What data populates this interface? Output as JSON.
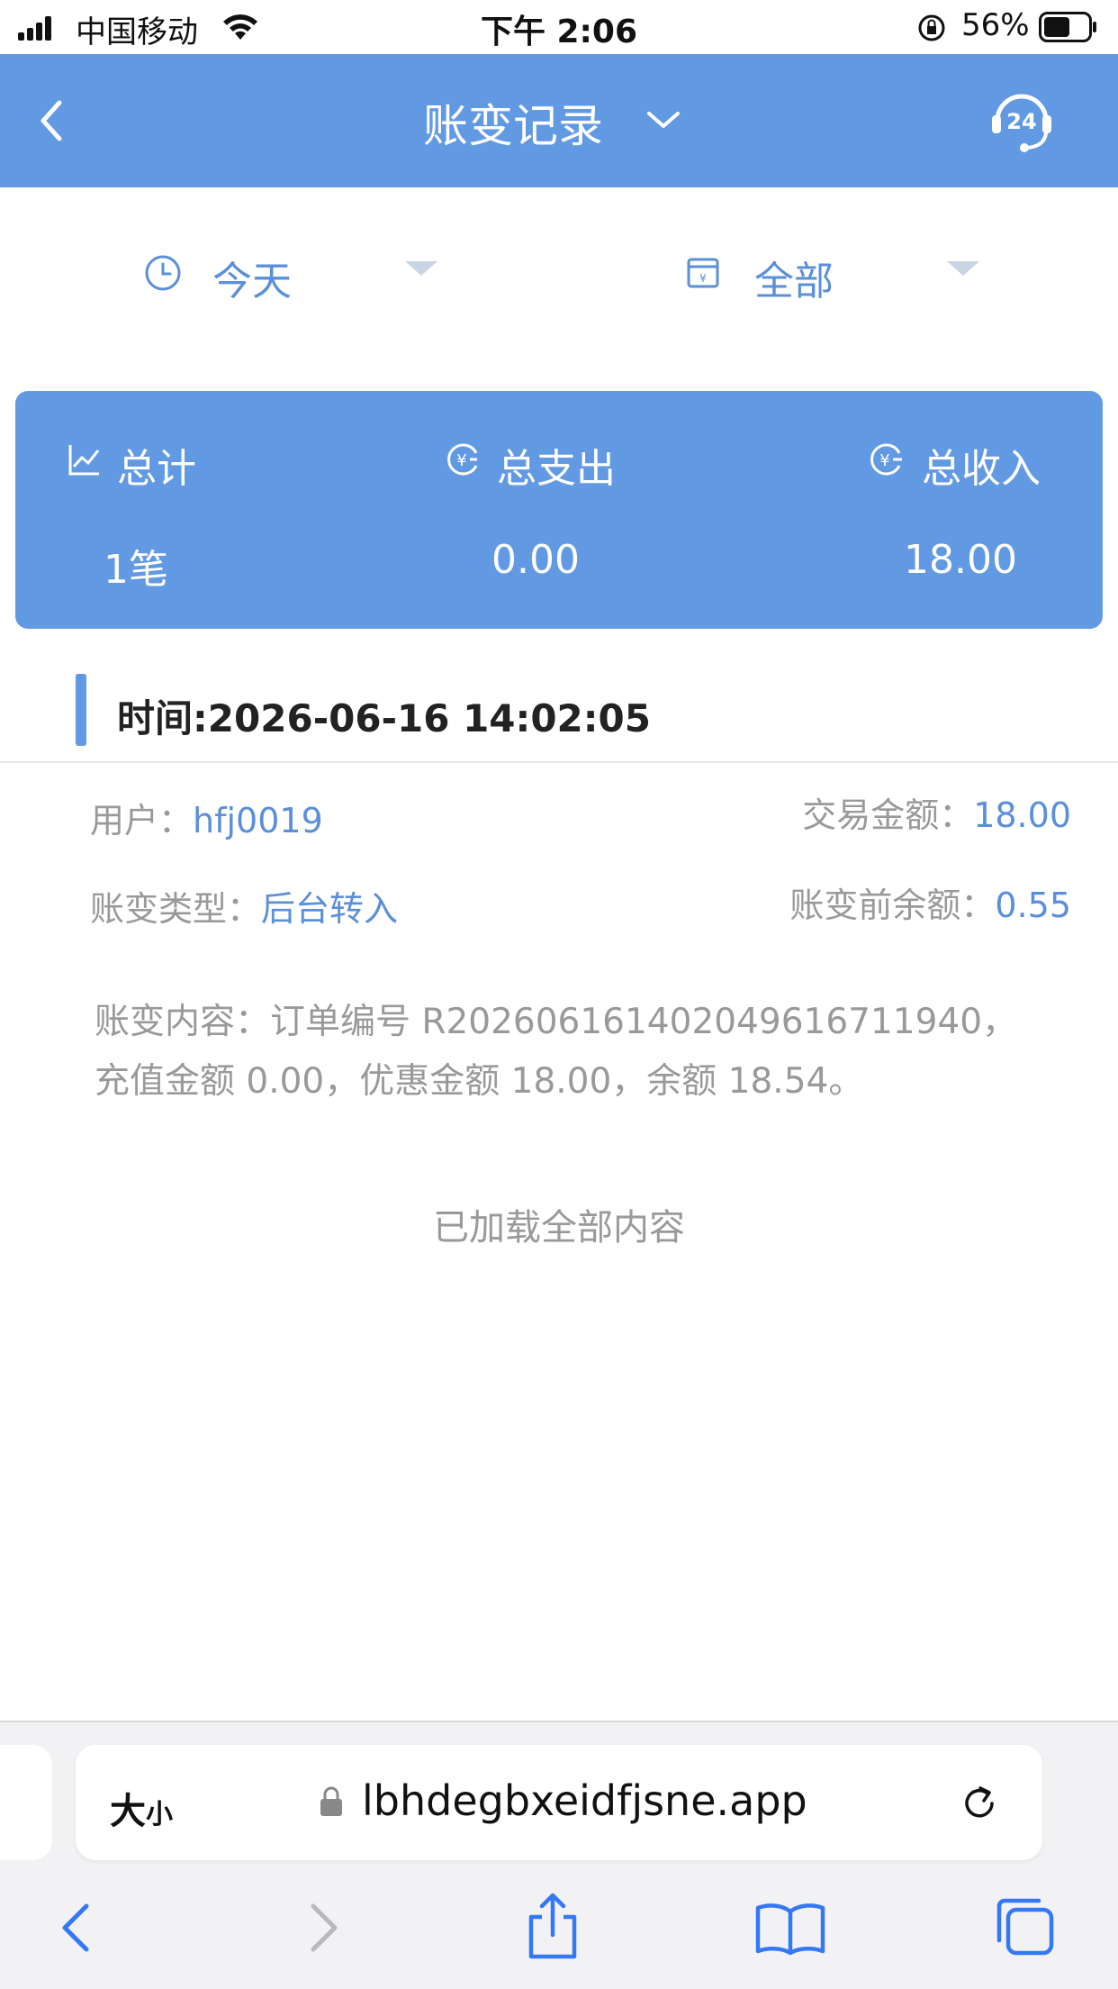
{
  "status_bar": {
    "carrier": "中国移动",
    "time": "下午 2:06",
    "battery": "56%"
  },
  "header": {
    "title": "账变记录",
    "support_badge": "24"
  },
  "filters": {
    "date": "今天",
    "type": "全部"
  },
  "summary": {
    "total_label": "总计",
    "total_value": "1笔",
    "expense_label": "总支出",
    "expense_value": "0.00",
    "income_label": "总收入",
    "income_value": "18.00"
  },
  "record": {
    "time": "时间:2026-06-16 14:02:05",
    "user_label": "用户：",
    "user_value": "hfj0019",
    "amount_label": "交易金额：",
    "amount_value": "18.00",
    "type_label": "账变类型：",
    "type_value": "后台转入",
    "balance_before_label": "账变前余额：",
    "balance_before_value": "0.55",
    "content": "账变内容：订单编号 R202606161402049616711940，充值金额 0.00，优惠金额 18.00，余额 18.54。"
  },
  "footer_note": "已加载全部内容",
  "browser": {
    "size_big": "大",
    "size_small": "小",
    "url": "lbhdegbxeidfjsne.app"
  },
  "colors": {
    "accent": "#6199e3",
    "link": "#5b8fd9",
    "muted": "#999999"
  }
}
